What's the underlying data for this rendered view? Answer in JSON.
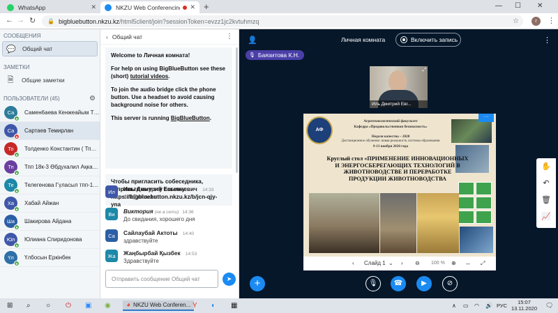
{
  "browser": {
    "tabs": [
      {
        "title": "WhatsApp",
        "active": false
      },
      {
        "title": "NKZU Web Conferencing - (",
        "active": true
      }
    ],
    "url_host": "bigbluebutton.nkzu.kz",
    "url_rest": "/html5client/join?sessionToken=evzz1jc2kvtuhmzq",
    "profile_initial": "r"
  },
  "left": {
    "messages_header": "СООБЩЕНИЯ",
    "public_chat_label": "Общий чат",
    "notes_header": "ЗАМЕТКИ",
    "shared_notes_label": "Общие заметки",
    "users_header": "ПОЛЬЗОВАТЕЛИ (45)",
    "users": [
      {
        "initials": "Са",
        "name": "Самен6аева Кенжеайым Тіле",
        "color": "#2e7d9a",
        "mic": "#4caf50"
      },
      {
        "initials": "Са",
        "name": "Сартаев Темирлан",
        "color": "#3f57a8",
        "mic": "#e53935"
      },
      {
        "initials": "То",
        "name": "Толденко Константин ( Тплк...",
        "color": "#c62828",
        "mic": "#4caf50"
      },
      {
        "initials": "Тп",
        "name": "Тпп 18к-3 Өбдухалил Ақкари...",
        "color": "#6a3fa0",
        "mic": "#4caf50"
      },
      {
        "initials": "Те",
        "name": "Телегенова Гүласыл тпп-18-3",
        "color": "#1e88a8",
        "mic": "#4caf50"
      },
      {
        "initials": "Ха",
        "name": "Хабай Айжан",
        "color": "#3f57a8",
        "mic": "#4caf50"
      },
      {
        "initials": "Ша",
        "name": "Шакирова Айдана",
        "color": "#2b5fa5",
        "mic": "#4caf50"
      },
      {
        "initials": "Юл",
        "name": "Юлиана Спиридонова",
        "color": "#3f57a8",
        "mic": "#4caf50"
      },
      {
        "initials": "Үл",
        "name": "Үлбосын Еркінбек",
        "color": "#2e6fa8",
        "mic": "#4caf50"
      }
    ]
  },
  "chat": {
    "title": "Общий чат",
    "welcome_line1_pre": "Welcome to ",
    "welcome_line1_bold": "Личная комната",
    "welcome_line1_post": "!",
    "welcome_help_pre": "For help on using BigBlueButton see these (short) ",
    "welcome_help_link": "tutorial videos",
    "welcome_help_post": ".",
    "welcome_audio": "To join the audio bridge click the phone button. Use a headset to avoid causing background noise for others.",
    "welcome_server_pre": "This server is running ",
    "welcome_server_link": "BigBlueButton",
    "welcome_server_post": ".",
    "invite_text": "Чтобы пригласить собеседника, отправьте ему эту ссылку:",
    "invite_link": "https://bigbluebutton.nkzu.kz/b/jcn-qjy-yna",
    "messages": [
      {
        "initials": "Ил",
        "color": "#3f57a8",
        "name": "Иль Дмитрий Евгениевич",
        "offline": "",
        "time": "14:33",
        "text": "deil@nkzu.kz"
      },
      {
        "initials": "Ви",
        "color": "#1e88a8",
        "name": "Виктория",
        "offline": "(не в сети)",
        "time": "14:36",
        "text": "До свидания, хорошего дня"
      },
      {
        "initials": "Са",
        "color": "#2b5fa5",
        "name": "Сайлаубай Актоты",
        "offline": "",
        "time": "14:40",
        "text": "здравствуйте"
      },
      {
        "initials": "Жа",
        "color": "#1e88a8",
        "name": "Жаңбырбай Қызбек",
        "offline": "",
        "time": "14:53",
        "text": "Здравствуйте"
      }
    ],
    "input_placeholder": "Отправить сообщение Общий чат"
  },
  "main": {
    "room_title": "Личная комната",
    "record_label": "Включить запись",
    "talker": "Баязитова К.Н.",
    "webcam_name": "Иль Дмитрий Евг...",
    "slide": {
      "org_line1": "Агротехнологический факультет",
      "org_line2": "Кафедра «Продовольственная безопасность»",
      "week_line": "Неделя качества – 2020",
      "theme_line": "Дистанционное обучение: новая реальность системы образования",
      "dates_line": "9-13 ноября 2020 года",
      "title": "Круглый стол «ПРИМЕНЕНИЕ ИННОВАЦИОННЫХ И ЭНЕРГОСБЕРЕГАЮЩИХ ТЕХНОЛОГИЙ В ЖИВОТНОВОДСТВЕ И ПЕРЕРАБОТКЕ ПРОДУКЦИИ ЖИВОТНОВОДСТВА"
    },
    "slide_label": "Слайд 1",
    "zoom": "100 %"
  },
  "taskbar": {
    "active_app": "NKZU Web Conferen...",
    "lang": "РУС",
    "time": "15:07",
    "date": "13.11.2020"
  }
}
